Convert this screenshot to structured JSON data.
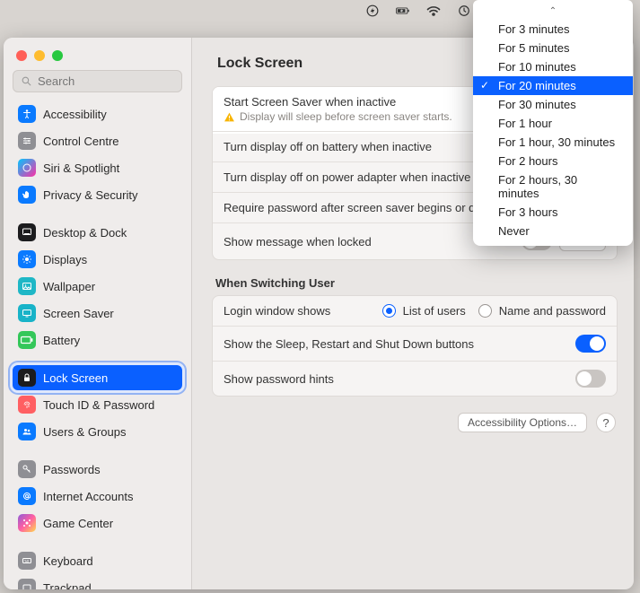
{
  "menubar_icons": [
    "bolt",
    "battery",
    "wifi",
    "clock",
    "search",
    "control"
  ],
  "search_placeholder": "Search",
  "page_title": "Lock Screen",
  "sidebar": {
    "items": [
      {
        "label": "Accessibility",
        "icon": "accessibility",
        "bg": "#0a7aff"
      },
      {
        "label": "Control Centre",
        "icon": "sliders",
        "bg": "#8f8f94"
      },
      {
        "label": "Siri & Spotlight",
        "icon": "siri",
        "bg": "linear-gradient(135deg,#00c6ff,#ff2ea6)"
      },
      {
        "label": "Privacy & Security",
        "icon": "hand",
        "bg": "#0a7aff"
      },
      {
        "gap": true
      },
      {
        "label": "Desktop & Dock",
        "icon": "dock",
        "bg": "#1c1c1e"
      },
      {
        "label": "Displays",
        "icon": "sun",
        "bg": "#0a7aff"
      },
      {
        "label": "Wallpaper",
        "icon": "photo",
        "bg": "#1fb7c6"
      },
      {
        "label": "Screen Saver",
        "icon": "screen",
        "bg": "#18b3c8"
      },
      {
        "label": "Battery",
        "icon": "battery",
        "bg": "#34c759"
      },
      {
        "gap": true
      },
      {
        "label": "Lock Screen",
        "icon": "lock",
        "bg": "#1c1c1e",
        "selected": true
      },
      {
        "label": "Touch ID & Password",
        "icon": "fingerprint",
        "bg": "#ff5f62"
      },
      {
        "label": "Users & Groups",
        "icon": "users",
        "bg": "#0a7aff"
      },
      {
        "gap": true
      },
      {
        "label": "Passwords",
        "icon": "key",
        "bg": "#8f8f94"
      },
      {
        "label": "Internet Accounts",
        "icon": "at",
        "bg": "#0a7aff"
      },
      {
        "label": "Game Center",
        "icon": "game",
        "bg": "linear-gradient(135deg,#8f5bd8,#ff5fa2,#ffd84d)"
      },
      {
        "gap": true
      },
      {
        "label": "Keyboard",
        "icon": "keyboard",
        "bg": "#8f8f94"
      },
      {
        "label": "Trackpad",
        "icon": "trackpad",
        "bg": "#8f8f94"
      }
    ]
  },
  "panel1": {
    "r0_label": "Start Screen Saver when inactive",
    "r0_sub": "Display will sleep before screen saver starts.",
    "r1_label": "Turn display off on battery when inactive",
    "r2_label": "Turn display off on power adapter when inactive",
    "r3_label": "Require password after screen saver begins or display is turned off",
    "r4_label": "Show message when locked",
    "r4_btn": "Set…"
  },
  "section_switch_title": "When Switching User",
  "panel2": {
    "r0_label": "Login window shows",
    "r0_opt1": "List of users",
    "r0_opt2": "Name and password",
    "r1_label": "Show the Sleep, Restart and Shut Down buttons",
    "r2_label": "Show password hints"
  },
  "bottom": {
    "acc_btn": "Accessibility Options…",
    "help": "?"
  },
  "dropdown": {
    "items": [
      {
        "label": "For 3 minutes"
      },
      {
        "label": "For 5 minutes"
      },
      {
        "label": "For 10 minutes"
      },
      {
        "label": "For 20 minutes",
        "selected": true
      },
      {
        "label": "For 30 minutes"
      },
      {
        "label": "For 1 hour"
      },
      {
        "label": "For 1 hour, 30 minutes"
      },
      {
        "label": "For 2 hours"
      },
      {
        "label": "For 2 hours, 30 minutes"
      },
      {
        "label": "For 3 hours"
      },
      {
        "label": "Never"
      }
    ]
  }
}
